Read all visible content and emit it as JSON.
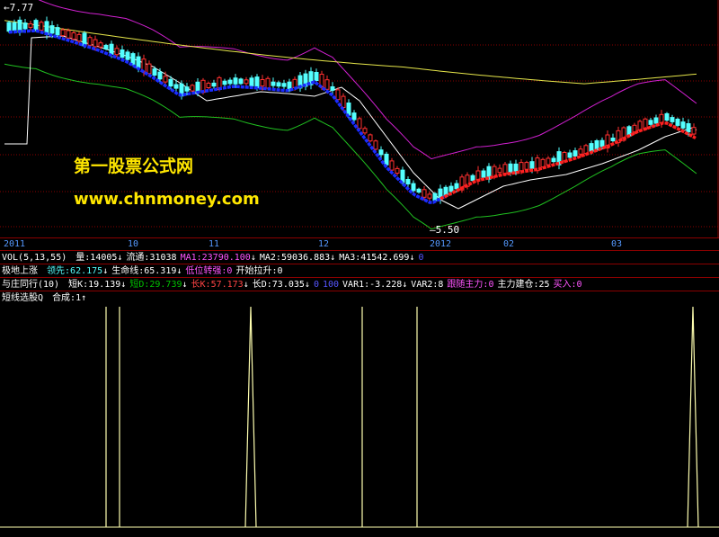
{
  "price_panel": {
    "high_label": "7.77",
    "low_label": "5.50",
    "watermark_title": "第一股票公式网",
    "watermark_url": "www.chnmoney.com"
  },
  "date_axis": [
    "2011",
    "10",
    "11",
    "12",
    "2012",
    "02",
    "03"
  ],
  "vol_line": {
    "name": "VOL(5,13,55)",
    "items": [
      {
        "label": "量:14005",
        "arrow": "↓",
        "color": "#ffffff"
      },
      {
        "label": "流通:31038",
        "arrow": "",
        "color": "#ffffff"
      },
      {
        "label": "MA1:23790.100",
        "arrow": "↓",
        "color": "#ff55ff"
      },
      {
        "label": "MA2:59036.883",
        "arrow": "↓",
        "color": "#ffffff"
      },
      {
        "label": "MA3:41542.699",
        "arrow": "↓",
        "color": "#ffffff"
      },
      {
        "label": "0",
        "arrow": "",
        "color": "#5555ff"
      }
    ]
  },
  "line2": {
    "name": "极地上涨",
    "items": [
      {
        "label": "领先:62.175",
        "arrow": "↓",
        "color": "#55ffff"
      },
      {
        "label": "生命线:65.319",
        "arrow": "↓",
        "color": "#ffffff"
      },
      {
        "label": "低位转强:0",
        "arrow": "",
        "color": "#ff55ff"
      },
      {
        "label": "开始拉升:0",
        "arrow": "",
        "color": "#ffffff"
      }
    ]
  },
  "line3": {
    "name": "与庄同行(10)",
    "items": [
      {
        "label": "短K:19.139",
        "arrow": "↓",
        "color": "#ffffff"
      },
      {
        "label": "短D:29.739",
        "arrow": "↓",
        "color": "#00c000"
      },
      {
        "label": "长K:57.173",
        "arrow": "↓",
        "color": "#ff4444"
      },
      {
        "label": "长D:73.035",
        "arrow": "↓",
        "color": "#ffffff"
      },
      {
        "label": "0",
        "arrow": "",
        "color": "#5555ff"
      },
      {
        "label": "100",
        "arrow": "",
        "color": "#5555ff"
      },
      {
        "label": "VAR1:-3.228",
        "arrow": "↓",
        "color": "#ffffff"
      },
      {
        "label": "VAR2:8",
        "arrow": "",
        "color": "#ffffff"
      },
      {
        "label": "跟随主力:0",
        "arrow": "",
        "color": "#ff55ff"
      },
      {
        "label": "主力建仓:25",
        "arrow": "",
        "color": "#ffffff"
      },
      {
        "label": "买入:0",
        "arrow": "",
        "color": "#ff55ff"
      }
    ]
  },
  "line4": {
    "name": "短线选股Q",
    "items": [
      {
        "label": "合成:1",
        "arrow": "↑",
        "color": "#ffffff"
      }
    ]
  },
  "colors": {
    "up_candle": "#ff3030",
    "down_candle": "#54ffff",
    "grid": "#8a0000",
    "upper_band": "#d020d0",
    "lower_band": "#20c020",
    "ma_long": "#e6e64a",
    "ma_mid": "#ffffff",
    "signal_line": "#ffffb0"
  }
}
